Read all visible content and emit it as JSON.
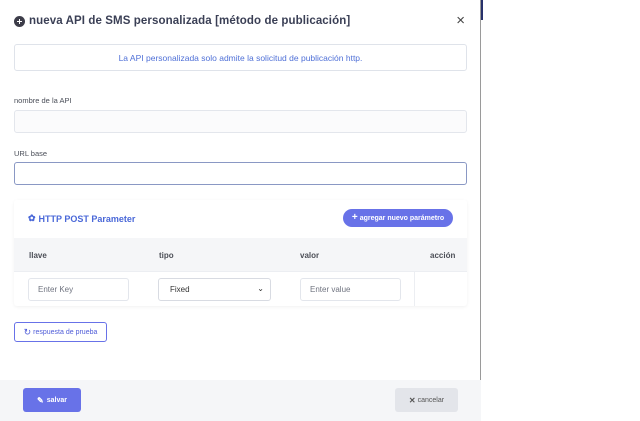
{
  "modal": {
    "title": "nueva API de SMS personalizada [método de publicación]",
    "close_icon": "×"
  },
  "alert": {
    "text": "La API personalizada solo admite la solicitud de publicación http."
  },
  "form": {
    "api_name_label": "nombre de la API",
    "api_name_value": "",
    "base_url_label": "URL base",
    "base_url_value": ""
  },
  "params": {
    "title": "HTTP POST Parameter",
    "add_button_label": "agregar nuevo parámetro",
    "columns": [
      "llave",
      "tipo",
      "valor",
      "acción"
    ],
    "row": {
      "key_placeholder": "Enter Key",
      "type_selected": "Fixed",
      "value_placeholder": "Enter value"
    }
  },
  "test_button_label": "respuesta de prueba",
  "footer": {
    "save_label": "salvar",
    "cancel_label": "cancelar"
  },
  "colors": {
    "accent": "#6872e8",
    "link_blue": "#4f70d7"
  }
}
